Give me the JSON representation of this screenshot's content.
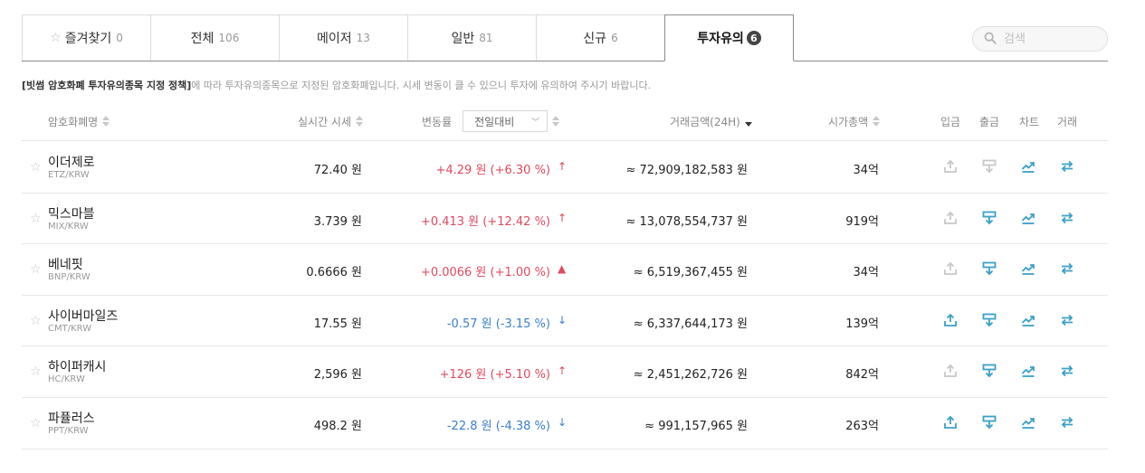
{
  "tabs": [
    {
      "label": "즐겨찾기",
      "count": "0"
    },
    {
      "label": "전체",
      "count": "106"
    },
    {
      "label": "메이저",
      "count": "13"
    },
    {
      "label": "일반",
      "count": "81"
    },
    {
      "label": "신규",
      "count": "6"
    },
    {
      "label": "투자유의",
      "count": "6"
    }
  ],
  "search": {
    "placeholder": "검색"
  },
  "notice": {
    "bold": "[빗썸 암호화폐 투자유의종목 지정 정책]",
    "text": "에 따라 투자유의종목으로 지정된 암호화폐입니다.  시세 변동이 클 수 있으니 투자에 유의하여 주시기 바랍니다."
  },
  "header": {
    "name": "암호화폐명",
    "price": "실시간 시세",
    "change": "변동률",
    "change_select": "전일대비",
    "volume": "거래금액(24H)",
    "cap": "시가총액",
    "deposit": "입금",
    "withdraw": "출금",
    "chart": "차트",
    "trade": "거래"
  },
  "colors": {
    "up": "#e04a5e",
    "down": "#3b7ecf",
    "icon_active": "#3ba0c8",
    "icon_disabled": "#c8c8c8"
  },
  "rows": [
    {
      "name": "이더제로",
      "pair": "ETZ/KRW",
      "price": "72.40 원",
      "change": "+4.29 원 (+6.30 %)",
      "dir": "up",
      "arrow": "↑",
      "volume": "≈ 72,909,182,583 원",
      "cap": "34억",
      "deposit_enabled": false,
      "withdraw_enabled": false
    },
    {
      "name": "믹스마블",
      "pair": "MIX/KRW",
      "price": "3.739 원",
      "change": "+0.413 원 (+12.42 %)",
      "dir": "up",
      "arrow": "↑",
      "volume": "≈ 13,078,554,737 원",
      "cap": "919억",
      "deposit_enabled": false,
      "withdraw_enabled": true
    },
    {
      "name": "베네핏",
      "pair": "BNP/KRW",
      "price": "0.6666 원",
      "change": "+0.0066 원 (+1.00 %)",
      "dir": "up",
      "arrow": "▲",
      "volume": "≈ 6,519,367,455 원",
      "cap": "34억",
      "deposit_enabled": false,
      "withdraw_enabled": true
    },
    {
      "name": "사이버마일즈",
      "pair": "CMT/KRW",
      "price": "17.55 원",
      "change": "-0.57 원 (-3.15 %)",
      "dir": "dn",
      "arrow": "↓",
      "volume": "≈ 6,337,644,173 원",
      "cap": "139억",
      "deposit_enabled": true,
      "withdraw_enabled": true
    },
    {
      "name": "하이퍼캐시",
      "pair": "HC/KRW",
      "price": "2,596 원",
      "change": "+126 원 (+5.10 %)",
      "dir": "up",
      "arrow": "↑",
      "volume": "≈ 2,451,262,726 원",
      "cap": "842억",
      "deposit_enabled": false,
      "withdraw_enabled": true
    },
    {
      "name": "파퓰러스",
      "pair": "PPT/KRW",
      "price": "498.2 원",
      "change": "-22.8 원 (-4.38 %)",
      "dir": "dn",
      "arrow": "↓",
      "volume": "≈ 991,157,965 원",
      "cap": "263억",
      "deposit_enabled": true,
      "withdraw_enabled": true
    }
  ]
}
